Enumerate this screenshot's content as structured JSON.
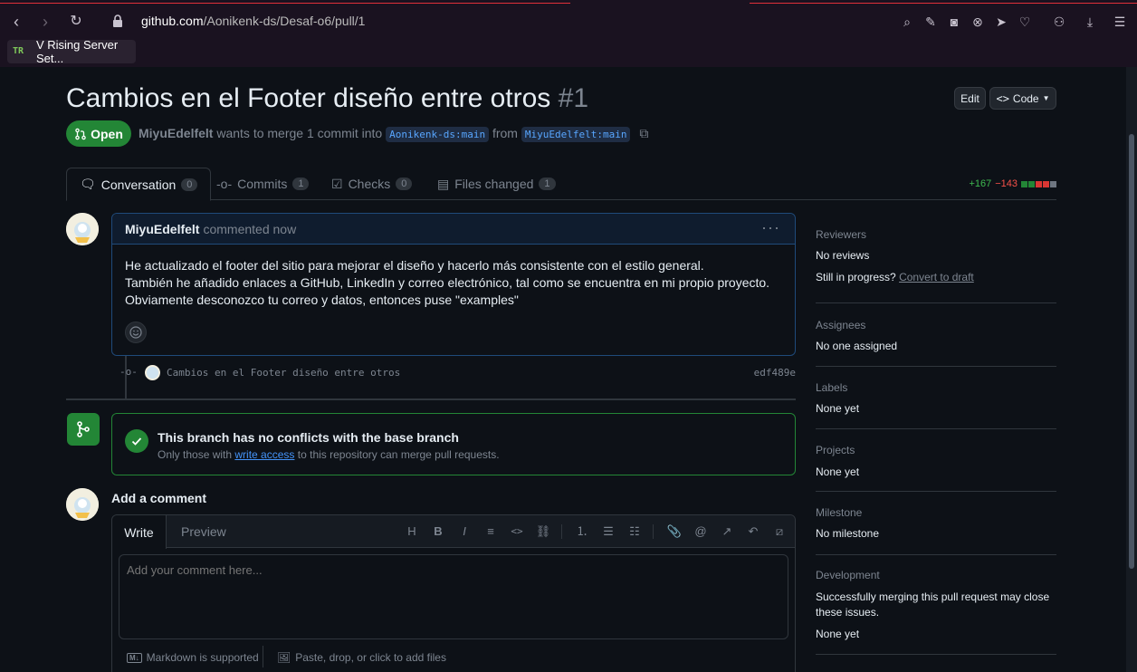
{
  "browser": {
    "url_domain": "github.com",
    "url_path": "/Aonikenk-ds/Desaf-o6/pull/1",
    "bookmark_label": "V Rising Server Set...",
    "bookmark_icon": "TR"
  },
  "pr": {
    "title": "Cambios en el Footer diseño entre otros",
    "number": "#1",
    "edit_label": "Edit",
    "code_label": "Code",
    "state_label": "Open",
    "author": "MiyuEdelfelt",
    "meta_text": "wants to merge 1 commit into",
    "base_branch": "Aonikenk-ds:main",
    "from_text": "from",
    "head_branch": "MiyuEdelfelt:main"
  },
  "tabs": [
    {
      "label": "Conversation",
      "count": "0"
    },
    {
      "label": "Commits",
      "count": "1"
    },
    {
      "label": "Checks",
      "count": "0"
    },
    {
      "label": "Files changed",
      "count": "1"
    }
  ],
  "diffstat": {
    "additions": "+167",
    "deletions": "−143",
    "colors": [
      "#238636",
      "#238636",
      "#da3633",
      "#da3633",
      "#6e7681"
    ]
  },
  "comment": {
    "author": "MiyuEdelfelt",
    "time": "commented now",
    "lines": [
      "He actualizado el footer del sitio para mejorar el diseño y hacerlo más consistente con el estilo general.",
      "También he añadido enlaces a GitHub, LinkedIn y correo electrónico, tal como se encuentra en mi propio proyecto.",
      "Obviamente desconozco tu correo y datos, entonces puse \"examples\""
    ]
  },
  "commit": {
    "message": "Cambios en el Footer diseño entre otros",
    "sha": "edf489e"
  },
  "merge": {
    "title": "This branch has no conflicts with the base branch",
    "sub_prefix": "Only those with",
    "sub_link": "write access",
    "sub_suffix": "to this repository can merge pull requests."
  },
  "add_comment": {
    "title": "Add a comment",
    "tab_write": "Write",
    "tab_preview": "Preview",
    "placeholder": "Add your comment here...",
    "markdown_note": "Markdown is supported",
    "attach_note": "Paste, drop, or click to add files"
  },
  "sidebar": {
    "reviewers": {
      "heading": "Reviewers",
      "value": "No reviews",
      "progress_prefix": "Still in progress?",
      "progress_link": "Convert to draft"
    },
    "assignees": {
      "heading": "Assignees",
      "value": "No one assigned"
    },
    "labels": {
      "heading": "Labels",
      "value": "None yet"
    },
    "projects": {
      "heading": "Projects",
      "value": "None yet"
    },
    "milestone": {
      "heading": "Milestone",
      "value": "No milestone"
    },
    "development": {
      "heading": "Development",
      "note": "Successfully merging this pull request may close these issues.",
      "value": "None yet"
    }
  },
  "colors": {
    "accent": "#238636",
    "link": "#4493f8",
    "bg": "#0d1117",
    "border": "#30363d"
  }
}
